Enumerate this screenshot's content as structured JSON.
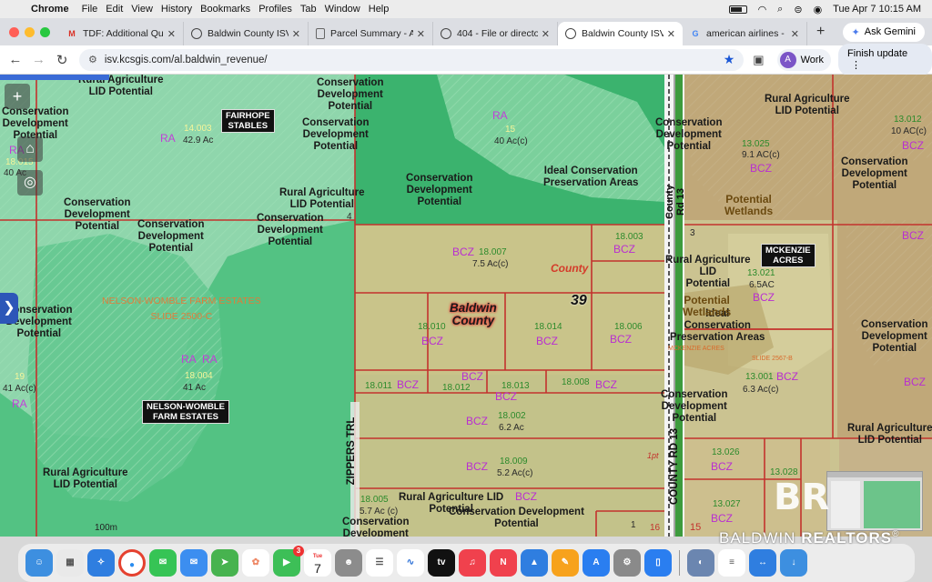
{
  "menubar": {
    "app": "Chrome",
    "items": [
      "File",
      "Edit",
      "View",
      "History",
      "Bookmarks",
      "Profiles",
      "Tab",
      "Window",
      "Help"
    ],
    "clock": "Tue Apr 7  10:15 AM"
  },
  "tabs": [
    {
      "title": "TDF: Additional Ques",
      "icon": "gmail-icon",
      "active": false
    },
    {
      "title": "Baldwin County ISV3",
      "icon": "globe-icon",
      "active": false
    },
    {
      "title": "Parcel Summary - As",
      "icon": "document-icon",
      "active": false
    },
    {
      "title": "404 - File or director",
      "icon": "globe-icon",
      "active": false
    },
    {
      "title": "Baldwin County ISV3",
      "icon": "globe-icon",
      "active": true
    },
    {
      "title": "american airlines - G",
      "icon": "google-icon",
      "active": false
    }
  ],
  "toolbar": {
    "url": "isv.kcsgis.com/al.baldwin_revenue/",
    "ask_gemini": "Ask Gemini",
    "profile_initial": "A",
    "profile_name": "Work",
    "finish_update": "Finish update"
  },
  "map": {
    "labels": [
      {
        "text": "Rural Agriculture\nLID Potential"
      },
      {
        "text": "Conservation\nDevelopment\nPotential"
      },
      {
        "text": "Conservation\nDevelopment\nPotential"
      },
      {
        "text": "Conservation\nDevelopment\nPotential"
      },
      {
        "text": "Conservation\nDevelopment\nPotential"
      },
      {
        "text": "Ideal Conservation\nPreservation Areas"
      },
      {
        "text": "Rural Agriculture\nLID Potential"
      },
      {
        "text": "Conservation\nDevelopment\nPotential"
      },
      {
        "text": "Rural Agriculture\nLID Potential"
      },
      {
        "text": "Conservation\nDevelopment\nPotential"
      },
      {
        "text": "Conservation\nDevelopment\nPotential"
      },
      {
        "text": "Conservation\nDevelopment\nPotential"
      },
      {
        "text": "Conservation\nDevelopment\nPotential"
      },
      {
        "text": "Rural Agriculture\nLID\nPotential"
      },
      {
        "text": "Ideal\nConservation\nPreservation Areas"
      },
      {
        "text": "Conservation\nDevelopment\nPotential"
      },
      {
        "text": "Conservation\nDevelopment\nPotential"
      },
      {
        "text": "Rural Agriculture\nLID Potential"
      },
      {
        "text": "Rural Agriculture\nLID Potential"
      },
      {
        "text": "Rural Agriculture LID\nPotential"
      },
      {
        "text": "Conservation Development\nPotential"
      },
      {
        "text": "Conservation\nDevelopment"
      },
      {
        "text": "Conservation\nDevelopment\nPotential"
      }
    ],
    "wetlands": [
      "Potential\nWetlands",
      "Potential\nWetlands"
    ],
    "parcel_ids": [
      "14.003",
      "15",
      "13.012",
      "13.025",
      "18.003",
      "18.007",
      "13.021",
      "18.010",
      "18.014",
      "18.006",
      "13.001",
      "18.011",
      "18.012",
      "18.013",
      "18.008",
      "18.002",
      "18.009",
      "13.026",
      "13.028",
      "13.027",
      "18.005",
      "18.004",
      "19",
      "18.015"
    ],
    "acreages": [
      "42.9 Ac",
      "40 Ac(c)",
      "10 AC(c)",
      "9.1 AC(c)",
      "7.5 Ac(c)",
      "6.5AC",
      "6.3 Ac(c)",
      "6.2 Ac",
      "5.2 Ac(c)",
      "5.7 Ac (c)",
      "41 Ac",
      "41 Ac(c)",
      "40 Ac"
    ],
    "zones": [
      "RA",
      "RA",
      "RA",
      "RA",
      "RA",
      "RA",
      "BCZ",
      "BCZ",
      "BCZ",
      "BCZ",
      "BCZ",
      "BCZ",
      "BCZ",
      "BCZ",
      "BCZ",
      "BCZ",
      "BCZ",
      "BCZ",
      "BCZ",
      "BCZ",
      "BCZ",
      "BCZ",
      "BCZ",
      "BCZ",
      "BCZ",
      "BCZ"
    ],
    "subdivisions": [
      "FAIRHOPE\nSTABLES",
      "MCKENZIE\nACRES",
      "NELSON-WOMBLE\nFARM ESTATES"
    ],
    "watermark_text": "NELSON-WOMBLE FARM ESTATES\nSLIDE 2500-C",
    "county_label": "County",
    "baldwin_county": "Baldwin\nCounty",
    "section_number": "39",
    "roads": [
      "County\nRd 13",
      "ZIPPERS TRL",
      "COUNTY RD 13"
    ],
    "scale": "100m",
    "small_numbers": [
      "3",
      "4",
      "1",
      "16",
      "15"
    ],
    "mckenzie_note": "MCKENZIE ACRES",
    "slide_note": "SLIDE 2567-B",
    "pt_label": "1pt"
  },
  "overlay": {
    "brand_mark": "BR",
    "brand_text_light": "BALDWIN ",
    "brand_text_bold": "REALTORS",
    "brand_reg": "®"
  },
  "dock": {
    "calendar_month": "Tue",
    "calendar_day": "7",
    "messages_badge": "3"
  }
}
